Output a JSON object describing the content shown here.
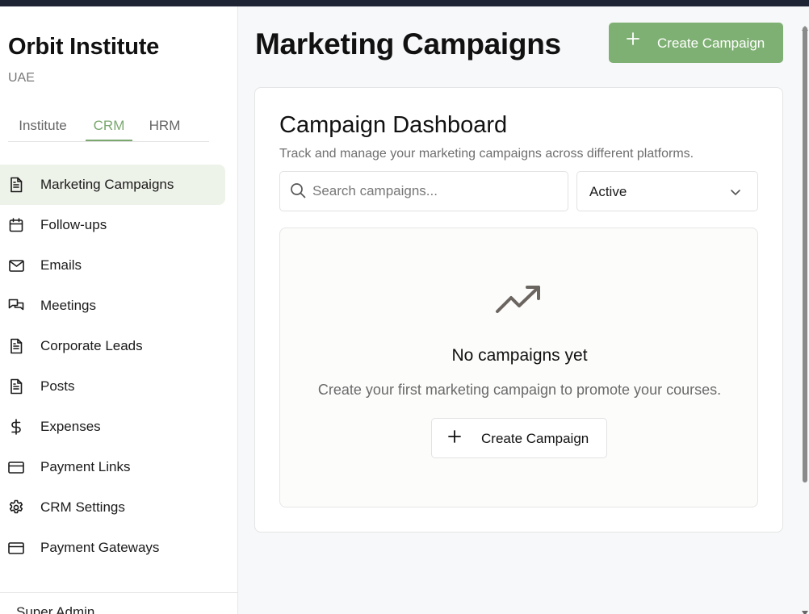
{
  "sidebar": {
    "org_name": "Orbit Institute",
    "org_region": "UAE",
    "tabs": [
      {
        "label": "Institute",
        "active": false
      },
      {
        "label": "CRM",
        "active": true
      },
      {
        "label": "HRM",
        "active": false
      }
    ],
    "items": [
      {
        "label": "Marketing Campaigns",
        "icon": "document-icon",
        "active": true
      },
      {
        "label": "Follow-ups",
        "icon": "calendar-icon",
        "active": false
      },
      {
        "label": "Emails",
        "icon": "mail-icon",
        "active": false
      },
      {
        "label": "Meetings",
        "icon": "chat-bubbles-icon",
        "active": false
      },
      {
        "label": "Corporate Leads",
        "icon": "document-icon",
        "active": false
      },
      {
        "label": "Posts",
        "icon": "document-icon",
        "active": false
      },
      {
        "label": "Expenses",
        "icon": "dollar-icon",
        "active": false
      },
      {
        "label": "Payment Links",
        "icon": "credit-card-icon",
        "active": false
      },
      {
        "label": "CRM Settings",
        "icon": "gear-icon",
        "active": false
      },
      {
        "label": "Payment Gateways",
        "icon": "credit-card-icon",
        "active": false
      }
    ],
    "user_name": "Super Admin"
  },
  "header": {
    "title": "Marketing Campaigns",
    "create_label": "Create Campaign"
  },
  "dashboard": {
    "title": "Campaign Dashboard",
    "subtitle": "Track and manage your marketing campaigns across different platforms.",
    "search_placeholder": "Search campaigns...",
    "status_filter": "Active",
    "empty_title": "No campaigns yet",
    "empty_text": "Create your first marketing campaign to promote your courses.",
    "empty_button_label": "Create Campaign"
  },
  "colors": {
    "accent": "#7fb073",
    "active_nav_bg": "#eef3ea",
    "top_bar": "#1e2434"
  }
}
